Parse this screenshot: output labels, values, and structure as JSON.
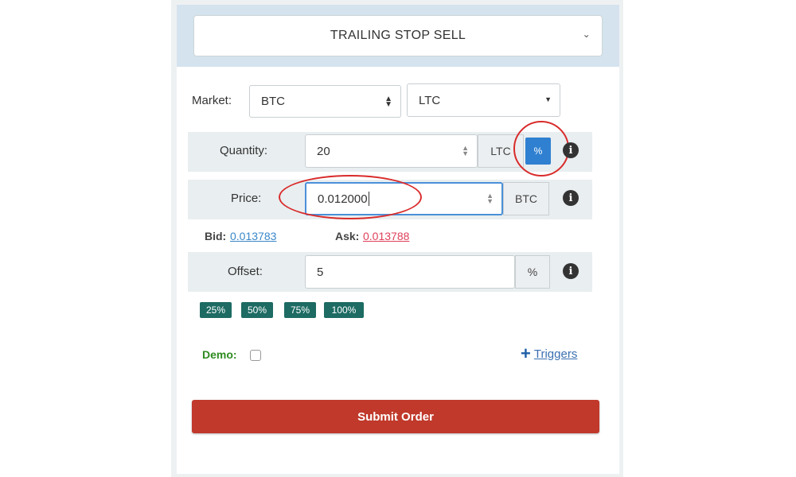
{
  "order_type": {
    "selected": "TRAILING STOP SELL"
  },
  "market": {
    "label": "Market:",
    "base": "BTC",
    "quote": "LTC"
  },
  "quantity": {
    "label": "Quantity:",
    "value": "20",
    "unit": "LTC",
    "percent_button": "%"
  },
  "price": {
    "label": "Price:",
    "value": "0.012000",
    "unit": "BTC"
  },
  "bid_ask": {
    "bid_label": "Bid:",
    "bid_value": "0.013783",
    "ask_label": "Ask:",
    "ask_value": "0.013788"
  },
  "offset": {
    "label": "Offset:",
    "value": "5",
    "unit": "%"
  },
  "percent_buttons": [
    "25%",
    "50%",
    "75%",
    "100%"
  ],
  "demo": {
    "label": "Demo:"
  },
  "triggers": {
    "icon": "+",
    "label": "Triggers"
  },
  "submit": {
    "label": "Submit Order"
  },
  "colors": {
    "accent": "#2f80d1",
    "submit": "#c0392b",
    "percent_btn": "#1d6b63",
    "bid": "#3a87c9",
    "ask": "#e0415a",
    "demo": "#2e8b1f",
    "annotation": "#d92b2b"
  }
}
